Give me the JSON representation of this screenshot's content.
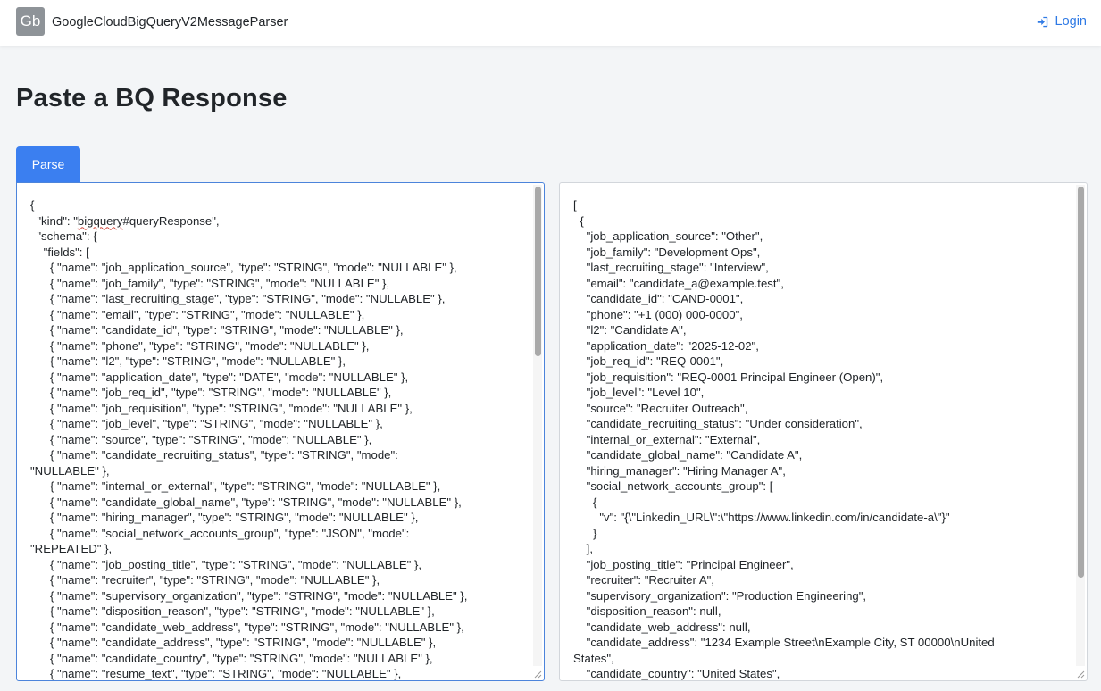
{
  "app": {
    "logo_text": "Gb",
    "title": "GoogleCloudBigQueryV2MessageParser"
  },
  "nav": {
    "login_label": "Login",
    "login_icon": "sign-in-icon"
  },
  "page": {
    "title": "Paste a BQ Response",
    "parse_label": "Parse"
  },
  "colors": {
    "accent": "#3b7ff0",
    "link": "#2f7ae5",
    "focus_border": "#4c84db"
  },
  "input_lines": [
    "{",
    "  \"kind\": \"bigquery#queryResponse\",",
    "  \"schema\": {",
    "    \"fields\": [",
    "      { \"name\": \"job_application_source\", \"type\": \"STRING\", \"mode\": \"NULLABLE\" },",
    "      { \"name\": \"job_family\", \"type\": \"STRING\", \"mode\": \"NULLABLE\" },",
    "      { \"name\": \"last_recruiting_stage\", \"type\": \"STRING\", \"mode\": \"NULLABLE\" },",
    "      { \"name\": \"email\", \"type\": \"STRING\", \"mode\": \"NULLABLE\" },",
    "      { \"name\": \"candidate_id\", \"type\": \"STRING\", \"mode\": \"NULLABLE\" },",
    "      { \"name\": \"phone\", \"type\": \"STRING\", \"mode\": \"NULLABLE\" },",
    "      { \"name\": \"l2\", \"type\": \"STRING\", \"mode\": \"NULLABLE\" },",
    "      { \"name\": \"application_date\", \"type\": \"DATE\", \"mode\": \"NULLABLE\" },",
    "      { \"name\": \"job_req_id\", \"type\": \"STRING\", \"mode\": \"NULLABLE\" },",
    "      { \"name\": \"job_requisition\", \"type\": \"STRING\", \"mode\": \"NULLABLE\" },",
    "      { \"name\": \"job_level\", \"type\": \"STRING\", \"mode\": \"NULLABLE\" },",
    "      { \"name\": \"source\", \"type\": \"STRING\", \"mode\": \"NULLABLE\" },",
    "      { \"name\": \"candidate_recruiting_status\", \"type\": \"STRING\", \"mode\":",
    "\"NULLABLE\" },",
    "      { \"name\": \"internal_or_external\", \"type\": \"STRING\", \"mode\": \"NULLABLE\" },",
    "      { \"name\": \"candidate_global_name\", \"type\": \"STRING\", \"mode\": \"NULLABLE\" },",
    "      { \"name\": \"hiring_manager\", \"type\": \"STRING\", \"mode\": \"NULLABLE\" },",
    "      { \"name\": \"social_network_accounts_group\", \"type\": \"JSON\", \"mode\":",
    "\"REPEATED\" },",
    "      { \"name\": \"job_posting_title\", \"type\": \"STRING\", \"mode\": \"NULLABLE\" },",
    "      { \"name\": \"recruiter\", \"type\": \"STRING\", \"mode\": \"NULLABLE\" },",
    "      { \"name\": \"supervisory_organization\", \"type\": \"STRING\", \"mode\": \"NULLABLE\" },",
    "      { \"name\": \"disposition_reason\", \"type\": \"STRING\", \"mode\": \"NULLABLE\" },",
    "      { \"name\": \"candidate_web_address\", \"type\": \"STRING\", \"mode\": \"NULLABLE\" },",
    "      { \"name\": \"candidate_address\", \"type\": \"STRING\", \"mode\": \"NULLABLE\" },",
    "      { \"name\": \"candidate_country\", \"type\": \"STRING\", \"mode\": \"NULLABLE\" },",
    "      { \"name\": \"resume_text\", \"type\": \"STRING\", \"mode\": \"NULLABLE\" },"
  ],
  "output_lines": [
    "[",
    "  {",
    "    \"job_application_source\": \"Other\",",
    "    \"job_family\": \"Development Ops\",",
    "    \"last_recruiting_stage\": \"Interview\",",
    "    \"email\": \"candidate_a@example.test\",",
    "    \"candidate_id\": \"CAND-0001\",",
    "    \"phone\": \"+1 (000) 000-0000\",",
    "    \"l2\": \"Candidate A\",",
    "    \"application_date\": \"2025-12-02\",",
    "    \"job_req_id\": \"REQ-0001\",",
    "    \"job_requisition\": \"REQ-0001 Principal Engineer (Open)\",",
    "    \"job_level\": \"Level 10\",",
    "    \"source\": \"Recruiter Outreach\",",
    "    \"candidate_recruiting_status\": \"Under consideration\",",
    "    \"internal_or_external\": \"External\",",
    "    \"candidate_global_name\": \"Candidate A\",",
    "    \"hiring_manager\": \"Hiring Manager A\",",
    "    \"social_network_accounts_group\": [",
    "      {",
    "        \"v\": \"{\\\"Linkedin_URL\\\":\\\"https://www.linkedin.com/in/candidate-a\\\"}\"",
    "      }",
    "    ],",
    "    \"job_posting_title\": \"Principal Engineer\",",
    "    \"recruiter\": \"Recruiter A\",",
    "    \"supervisory_organization\": \"Production Engineering\",",
    "    \"disposition_reason\": null,",
    "    \"candidate_web_address\": null,",
    "    \"candidate_address\": \"1234 Example Street\\nExample City, ST 00000\\nUnited",
    "States\",",
    "    \"candidate_country\": \"United States\","
  ]
}
